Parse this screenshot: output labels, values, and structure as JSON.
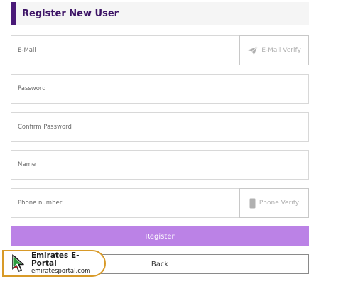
{
  "header": {
    "title": "Register New User"
  },
  "form": {
    "email": {
      "placeholder": "E-Mail",
      "verify_label": "E-Mail Verify",
      "verify_icon": "paper-plane-icon"
    },
    "password": {
      "placeholder": "Password"
    },
    "confirm_password": {
      "placeholder": "Confirm Password"
    },
    "name": {
      "placeholder": "Name"
    },
    "phone": {
      "placeholder": "Phone number",
      "verify_label": "Phone Verify",
      "verify_icon": "mobile-phone-icon"
    }
  },
  "actions": {
    "register_label": "Register",
    "back_label": "Back"
  },
  "watermark": {
    "title": "Emirates E-Portal",
    "url": "emiratesportal.com"
  },
  "colors": {
    "accent": "#4a1a78",
    "register_button": "#bb82e6",
    "watermark_border": "#d89a28"
  }
}
